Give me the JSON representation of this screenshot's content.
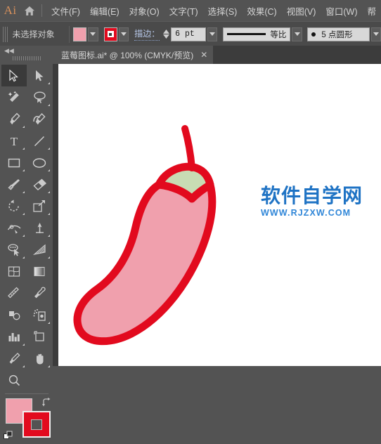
{
  "app": {
    "logo_text": "Ai",
    "home_icon": "home-icon"
  },
  "menubar": {
    "items": [
      {
        "label": "文件(F)"
      },
      {
        "label": "编辑(E)"
      },
      {
        "label": "对象(O)"
      },
      {
        "label": "文字(T)"
      },
      {
        "label": "选择(S)"
      },
      {
        "label": "效果(C)"
      },
      {
        "label": "视图(V)"
      },
      {
        "label": "窗口(W)"
      },
      {
        "label": "帮"
      }
    ]
  },
  "controlbar": {
    "selection_status": "未选择对象",
    "fill_color": "#f0a0ad",
    "stroke_color": "#e20a1e",
    "stroke_label": "描边：",
    "stroke_weight": "6 pt",
    "width_profile": "等比",
    "brush_definition": "5 点圆形",
    "fill_swatch_name": "fill-swatch",
    "stroke_swatch_name": "stroke-swatch"
  },
  "tabs": [
    {
      "title": "蓝莓图标.ai* @ 100% (CMYK/预览)",
      "close_label": "✕",
      "active": true
    }
  ],
  "toolpanel": {
    "collapse_label": "◀◀",
    "tools": [
      {
        "name": "selection-tool",
        "active": true,
        "has_flyout": false
      },
      {
        "name": "direct-selection-tool",
        "active": false,
        "has_flyout": true
      },
      {
        "name": "magic-wand-tool",
        "active": false,
        "has_flyout": false
      },
      {
        "name": "lasso-tool",
        "active": false,
        "has_flyout": false
      },
      {
        "name": "pen-tool",
        "active": false,
        "has_flyout": true
      },
      {
        "name": "curvature-tool",
        "active": false,
        "has_flyout": false
      },
      {
        "name": "type-tool",
        "active": false,
        "has_flyout": true
      },
      {
        "name": "line-segment-tool",
        "active": false,
        "has_flyout": true
      },
      {
        "name": "rectangle-tool",
        "active": false,
        "has_flyout": true
      },
      {
        "name": "ellipse-tool",
        "active": false,
        "has_flyout": true
      },
      {
        "name": "paintbrush-tool",
        "active": false,
        "has_flyout": true
      },
      {
        "name": "shaper-eraser-tool",
        "active": false,
        "has_flyout": true
      },
      {
        "name": "rotate-tool",
        "active": false,
        "has_flyout": true
      },
      {
        "name": "scale-tool",
        "active": false,
        "has_flyout": true
      },
      {
        "name": "width-warp-tool",
        "active": false,
        "has_flyout": true
      },
      {
        "name": "free-transform-tool",
        "active": false,
        "has_flyout": true
      },
      {
        "name": "shape-builder-tool",
        "active": false,
        "has_flyout": true
      },
      {
        "name": "perspective-grid-tool",
        "active": false,
        "has_flyout": true
      },
      {
        "name": "mesh-tool",
        "active": false,
        "has_flyout": false
      },
      {
        "name": "gradient-tool",
        "active": false,
        "has_flyout": false
      },
      {
        "name": "measure-tool",
        "active": false,
        "has_flyout": false
      },
      {
        "name": "eyedropper-tool",
        "active": false,
        "has_flyout": false
      },
      {
        "name": "blend-tool",
        "active": false,
        "has_flyout": false
      },
      {
        "name": "symbol-sprayer-tool",
        "active": false,
        "has_flyout": true
      },
      {
        "name": "column-graph-tool",
        "active": false,
        "has_flyout": true
      },
      {
        "name": "artboard-tool",
        "active": false,
        "has_flyout": false
      },
      {
        "name": "slice-tool",
        "active": false,
        "has_flyout": true
      },
      {
        "name": "hand-tool",
        "active": false,
        "has_flyout": true
      },
      {
        "name": "zoom-tool",
        "active": false,
        "has_flyout": false
      }
    ],
    "fill_color": "#f0a0ad",
    "stroke_color": "#e20a1e",
    "swap_icon": "swap-fill-stroke-icon",
    "default_icon": "default-fill-stroke-icon"
  },
  "canvas": {
    "background": "#ffffff",
    "artwork": {
      "name": "chili-pepper-illustration",
      "body_fill": "#f0a0ad",
      "cap_fill": "#c8dcb4",
      "stroke_color": "#e20a1e",
      "stroke_width": 6
    },
    "watermark": {
      "chinese": "软件自学网",
      "url": "WWW.RJZXW.COM",
      "color": "#1f73c4"
    }
  }
}
